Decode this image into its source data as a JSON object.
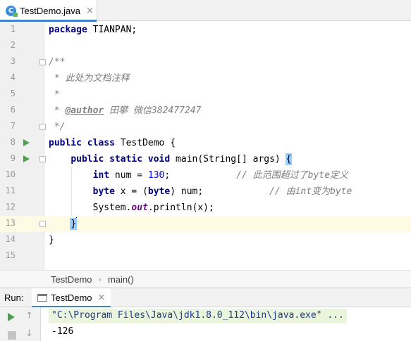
{
  "editor_tab": {
    "label": "TestDemo.java",
    "icon": "java-class-icon",
    "close": "×"
  },
  "code": {
    "line_numbers": [
      "1",
      "2",
      "3",
      "4",
      "5",
      "6",
      "7",
      "8",
      "9",
      "10",
      "11",
      "12",
      "13",
      "14",
      "15"
    ],
    "l1": {
      "kw": "package",
      "rest": " TIANPAN;"
    },
    "l3": "/**",
    "l4": " * 此处为文档注释",
    "l5": " *",
    "l6": {
      "prefix": " * ",
      "tag": "@author",
      "rest": " 田攀 微信382477247"
    },
    "l7": " */",
    "l8": {
      "kw1": "public",
      "kw2": "class",
      "rest": " TestDemo {"
    },
    "l9": {
      "indent": "    ",
      "kw1": "public",
      "kw2": "static",
      "kw3": "void",
      "rest": " main(String[] args) ",
      "brace": "{"
    },
    "l10": {
      "indent": "        ",
      "kw": "int",
      "mid": " num = ",
      "num": "130",
      "end": ";",
      "pad": "            ",
      "comment": "// 此范围超过了byte定义"
    },
    "l11": {
      "indent": "        ",
      "kw": "byte",
      "mid": " x = (",
      "kw2": "byte",
      "end": ") num;",
      "pad": "            ",
      "comment": "// 由int变为byte"
    },
    "l12": {
      "indent": "        ",
      "pre": "System.",
      "field": "out",
      "post": ".println(x);"
    },
    "l13": {
      "indent": "    ",
      "brace": "}"
    },
    "l14": "}"
  },
  "breadcrumb": {
    "class": "TestDemo",
    "method": "main()"
  },
  "run_panel": {
    "label": "Run:",
    "tab_label": "TestDemo",
    "tab_close": "×",
    "command": "\"C:\\Program Files\\Java\\jdk1.8.0_112\\bin\\java.exe\" ...",
    "output": "-126"
  },
  "colors": {
    "keyword": "#000080",
    "number": "#0000ff",
    "comment": "#808080",
    "static_field": "#660e7a",
    "run_green": "#4aa34a",
    "current_line": "#fffae3",
    "tab_accent": "#4083c9"
  }
}
